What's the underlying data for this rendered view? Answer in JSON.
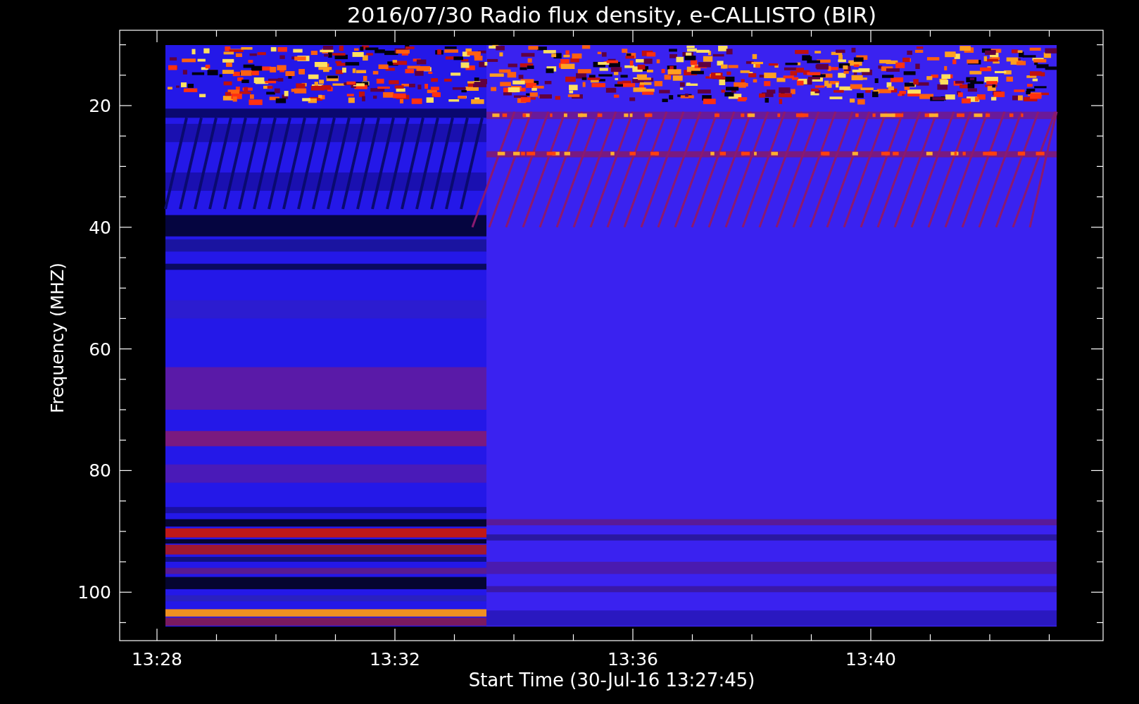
{
  "title": "2016/07/30  Radio flux density, e-CALLISTO (BIR)",
  "y_axis": {
    "label": "Frequency (MHZ)",
    "ticks": [
      "20",
      "40",
      "60",
      "80",
      "100"
    ]
  },
  "x_axis": {
    "label": "Start Time (30-Jul-16 13:27:45)",
    "ticks": [
      "13:28",
      "13:32",
      "13:36",
      "13:40"
    ]
  }
}
